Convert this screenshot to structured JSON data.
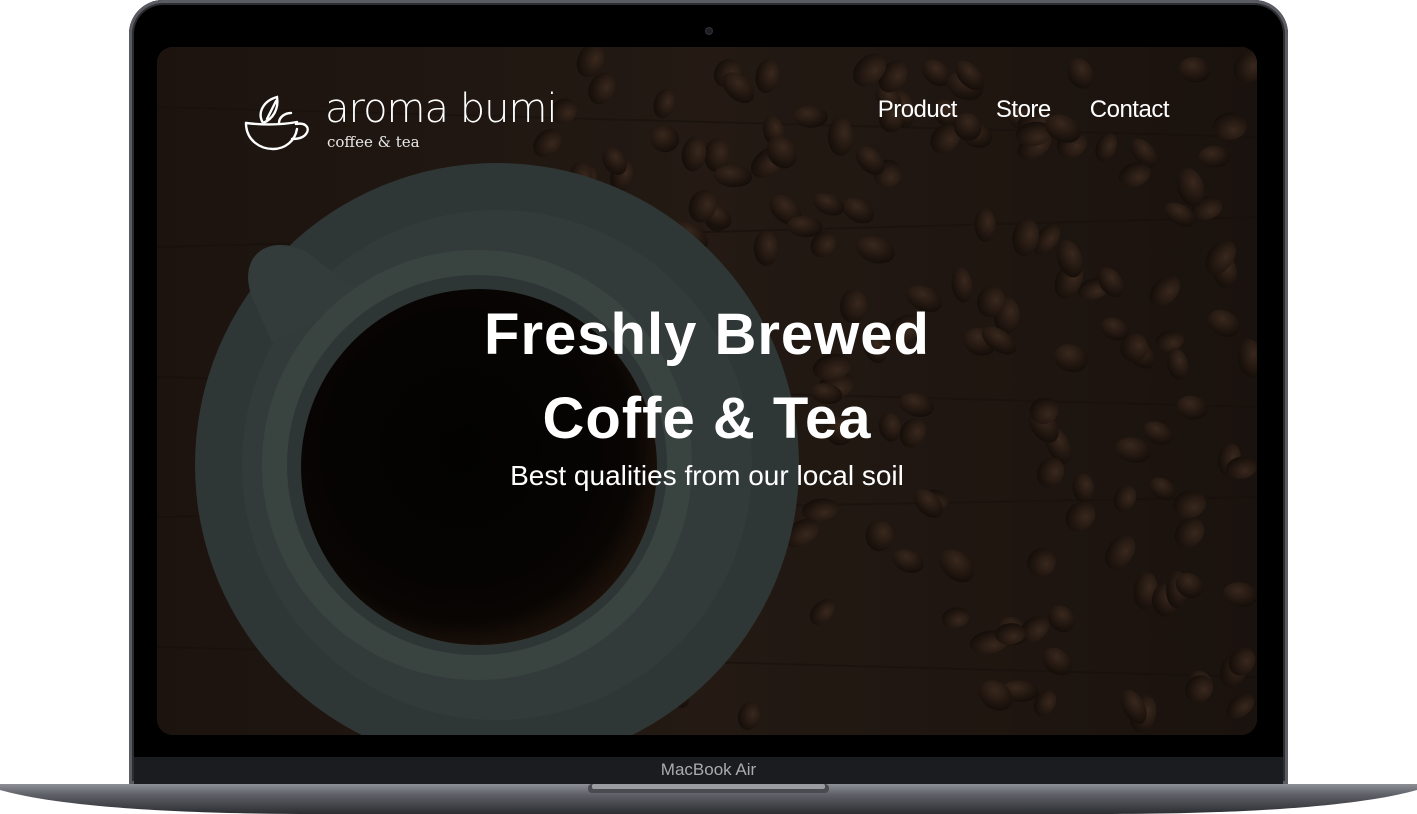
{
  "device": {
    "model_label": "MacBook Air"
  },
  "header": {
    "logo": {
      "name": "aroma bumi",
      "tagline": "coffee & tea",
      "icon": "teacup-leaf-icon"
    },
    "nav": [
      {
        "label": "Product"
      },
      {
        "label": "Store"
      },
      {
        "label": "Contact"
      }
    ]
  },
  "hero": {
    "title_line1": "Freshly Brewed",
    "title_line2": "Coffe & Tea",
    "subtitle": "Best qualities from our local soil"
  },
  "colors": {
    "text": "#ffffff",
    "overlay": "#000000",
    "background": "#2a1d16",
    "bezel": "#000000"
  }
}
